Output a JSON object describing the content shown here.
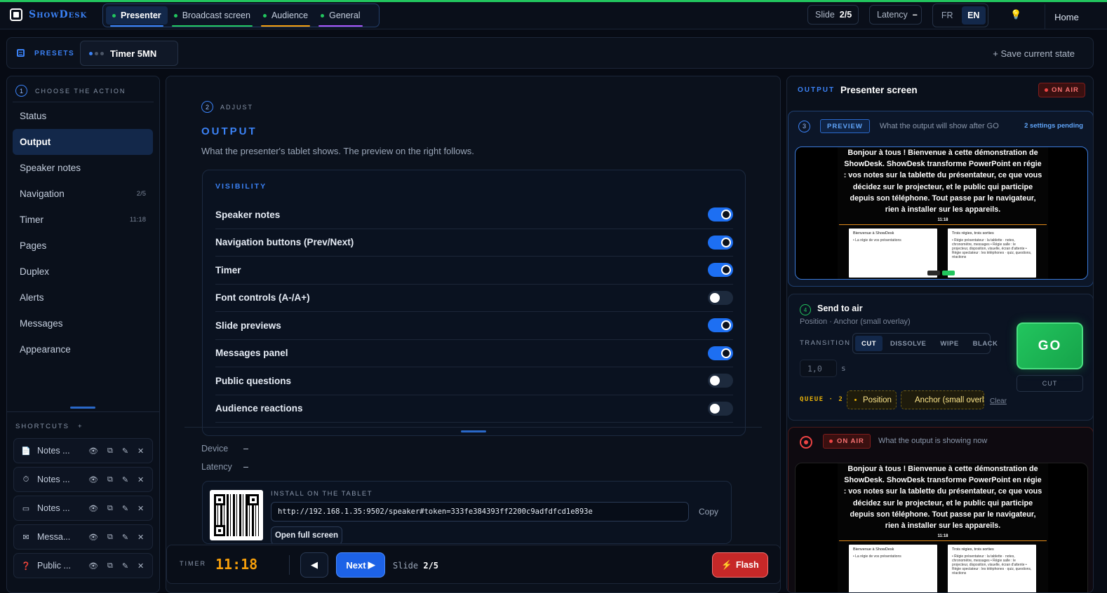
{
  "app": {
    "name": "ShowDesk"
  },
  "header": {
    "tabs": [
      {
        "label": "Presenter",
        "color": "#3b82f6"
      },
      {
        "label": "Broadcast screen",
        "color": "#22c55e"
      },
      {
        "label": "Audience",
        "color": "#f59e0b"
      },
      {
        "label": "General",
        "color": "#a855f7"
      }
    ],
    "slide_label": "Slide",
    "slide_value": "2/5",
    "latency_label": "Latency",
    "latency_value": "–",
    "languages": [
      "FR",
      "EN"
    ],
    "active_language": "EN",
    "home": "Home"
  },
  "presets": {
    "label": "PRESETS",
    "item": "Timer 5MN",
    "save": "+ Save current state"
  },
  "left": {
    "step_number": "1",
    "step_label": "CHOOSE THE ACTION",
    "nav": [
      {
        "label": "Status",
        "badge": ""
      },
      {
        "label": "Output",
        "badge": ""
      },
      {
        "label": "Speaker notes",
        "badge": ""
      },
      {
        "label": "Navigation",
        "badge": "2/5"
      },
      {
        "label": "Timer",
        "badge": "11:18"
      },
      {
        "label": "Pages",
        "badge": ""
      },
      {
        "label": "Duplex",
        "badge": ""
      },
      {
        "label": "Alerts",
        "badge": ""
      },
      {
        "label": "Messages",
        "badge": ""
      },
      {
        "label": "Appearance",
        "badge": ""
      }
    ],
    "shortcuts_label": "SHORTCUTS",
    "shortcuts_add": "+",
    "shortcuts": [
      {
        "icon": "📄",
        "label": "Notes ...",
        "icon_name": "document-icon"
      },
      {
        "icon": "⏱",
        "label": "Notes ...",
        "icon_name": "stopwatch-icon"
      },
      {
        "icon": "▭",
        "label": "Notes ...",
        "icon_name": "screen-icon"
      },
      {
        "icon": "✉",
        "label": "Messa...",
        "icon_name": "mail-icon"
      },
      {
        "icon": "❓",
        "label": "Public ...",
        "icon_name": "question-icon"
      }
    ]
  },
  "adjust": {
    "step_number": "2",
    "step_label": "ADJUST",
    "title": "OUTPUT",
    "subtitle": "What the presenter's tablet shows. The preview on the right follows.",
    "visibility_title": "VISIBILITY",
    "toggles": [
      {
        "label": "Speaker notes",
        "on": true
      },
      {
        "label": "Navigation buttons (Prev/Next)",
        "on": true
      },
      {
        "label": "Timer",
        "on": true
      },
      {
        "label": "Font controls (A-/A+)",
        "on": false
      },
      {
        "label": "Slide previews",
        "on": true
      },
      {
        "label": "Messages panel",
        "on": true
      },
      {
        "label": "Public questions",
        "on": false
      },
      {
        "label": "Audience reactions",
        "on": false
      }
    ],
    "device_label": "Device",
    "device_value": "–",
    "latency_label": "Latency",
    "latency_value": "–",
    "install_label": "INSTALL ON THE TABLET",
    "url": "http://192.168.1.35:9502/speaker#token=333fe384393ff2200c9adfdfcd1e893e",
    "copy": "Copy",
    "open_full": "Open full screen"
  },
  "controls": {
    "timer_label": "TIMER",
    "timer_value": "11:18",
    "next": "Next",
    "slide_label": "Slide",
    "slide_value": "2/5",
    "flash": "Flash"
  },
  "output": {
    "label": "OUTPUT",
    "title": "Presenter screen",
    "on_air": "ON AIR",
    "preview": {
      "step_number": "3",
      "badge": "PREVIEW",
      "desc": "What the output will show after GO",
      "pending": "2 settings pending"
    },
    "screen": {
      "notes": "Bonjour à tous ! Bienvenue à cette démonstration de ShowDesk. ShowDesk transforme PowerPoint en régie : vos notes sur la tablette du présentateur, ce que vous décidez sur le projecteur, et le public qui participe depuis son téléphone. Tout passe par le navigateur, rien à installer sur les appareils.",
      "time": "11:18",
      "thumb1_title": "Bienvenue à ShowDesk",
      "thumb1_text": "• La régie de vos présentations",
      "thumb2_title": "Trois régies, trois sorties",
      "thumb2_text": "• Régie présentateur : la tablette · notes, chronomètre, messages • Régie salle : le projecteur, disposition, visuelle, écran d'attente • Régie spectateur : les téléphones · quiz, questions, réactions"
    },
    "send": {
      "step_number": "4",
      "title": "Send to air",
      "subtitle": "Position · Anchor (small overlay)",
      "transition_label": "TRANSITION",
      "transitions": [
        "CUT",
        "DISSOLVE",
        "WIPE",
        "BLACK"
      ],
      "active_transition": "CUT",
      "duration": "1,0",
      "duration_unit": "s",
      "queue_label": "QUEUE · 2",
      "queue": [
        "Position",
        "Anchor (small overlay)"
      ],
      "clear": "Clear",
      "go": "GO",
      "go_sub": "CUT"
    },
    "live": {
      "badge": "ON AIR",
      "desc": "What the output is showing now"
    }
  },
  "colors": {
    "accent": "#3b82f6",
    "go": "#22c55e",
    "flash": "#dc2626",
    "timer": "#f59e0b",
    "queue": "#eab308"
  }
}
